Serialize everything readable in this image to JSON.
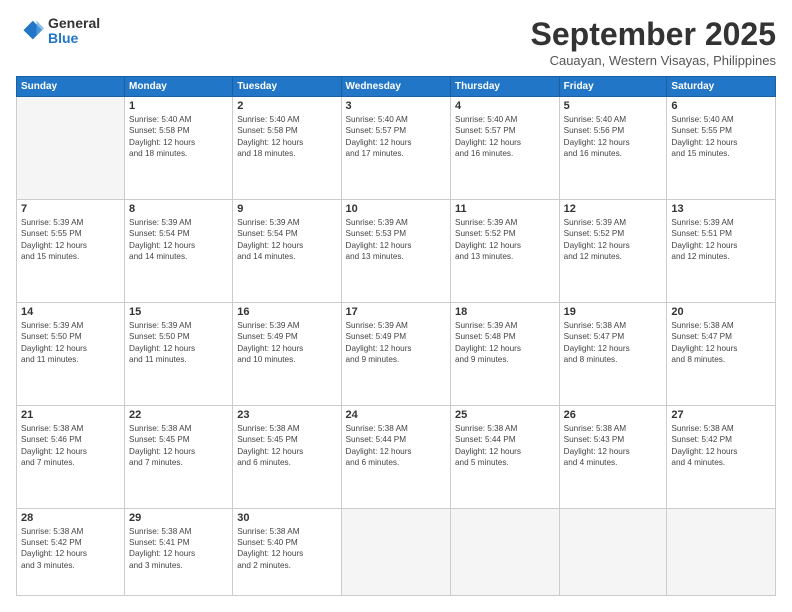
{
  "logo": {
    "general": "General",
    "blue": "Blue"
  },
  "title": "September 2025",
  "location": "Cauayan, Western Visayas, Philippines",
  "days_of_week": [
    "Sunday",
    "Monday",
    "Tuesday",
    "Wednesday",
    "Thursday",
    "Friday",
    "Saturday"
  ],
  "weeks": [
    [
      {
        "day": "",
        "info": ""
      },
      {
        "day": "1",
        "info": "Sunrise: 5:40 AM\nSunset: 5:58 PM\nDaylight: 12 hours\nand 18 minutes."
      },
      {
        "day": "2",
        "info": "Sunrise: 5:40 AM\nSunset: 5:58 PM\nDaylight: 12 hours\nand 18 minutes."
      },
      {
        "day": "3",
        "info": "Sunrise: 5:40 AM\nSunset: 5:57 PM\nDaylight: 12 hours\nand 17 minutes."
      },
      {
        "day": "4",
        "info": "Sunrise: 5:40 AM\nSunset: 5:57 PM\nDaylight: 12 hours\nand 16 minutes."
      },
      {
        "day": "5",
        "info": "Sunrise: 5:40 AM\nSunset: 5:56 PM\nDaylight: 12 hours\nand 16 minutes."
      },
      {
        "day": "6",
        "info": "Sunrise: 5:40 AM\nSunset: 5:55 PM\nDaylight: 12 hours\nand 15 minutes."
      }
    ],
    [
      {
        "day": "7",
        "info": "Sunrise: 5:39 AM\nSunset: 5:55 PM\nDaylight: 12 hours\nand 15 minutes."
      },
      {
        "day": "8",
        "info": "Sunrise: 5:39 AM\nSunset: 5:54 PM\nDaylight: 12 hours\nand 14 minutes."
      },
      {
        "day": "9",
        "info": "Sunrise: 5:39 AM\nSunset: 5:54 PM\nDaylight: 12 hours\nand 14 minutes."
      },
      {
        "day": "10",
        "info": "Sunrise: 5:39 AM\nSunset: 5:53 PM\nDaylight: 12 hours\nand 13 minutes."
      },
      {
        "day": "11",
        "info": "Sunrise: 5:39 AM\nSunset: 5:52 PM\nDaylight: 12 hours\nand 13 minutes."
      },
      {
        "day": "12",
        "info": "Sunrise: 5:39 AM\nSunset: 5:52 PM\nDaylight: 12 hours\nand 12 minutes."
      },
      {
        "day": "13",
        "info": "Sunrise: 5:39 AM\nSunset: 5:51 PM\nDaylight: 12 hours\nand 12 minutes."
      }
    ],
    [
      {
        "day": "14",
        "info": "Sunrise: 5:39 AM\nSunset: 5:50 PM\nDaylight: 12 hours\nand 11 minutes."
      },
      {
        "day": "15",
        "info": "Sunrise: 5:39 AM\nSunset: 5:50 PM\nDaylight: 12 hours\nand 11 minutes."
      },
      {
        "day": "16",
        "info": "Sunrise: 5:39 AM\nSunset: 5:49 PM\nDaylight: 12 hours\nand 10 minutes."
      },
      {
        "day": "17",
        "info": "Sunrise: 5:39 AM\nSunset: 5:49 PM\nDaylight: 12 hours\nand 9 minutes."
      },
      {
        "day": "18",
        "info": "Sunrise: 5:39 AM\nSunset: 5:48 PM\nDaylight: 12 hours\nand 9 minutes."
      },
      {
        "day": "19",
        "info": "Sunrise: 5:38 AM\nSunset: 5:47 PM\nDaylight: 12 hours\nand 8 minutes."
      },
      {
        "day": "20",
        "info": "Sunrise: 5:38 AM\nSunset: 5:47 PM\nDaylight: 12 hours\nand 8 minutes."
      }
    ],
    [
      {
        "day": "21",
        "info": "Sunrise: 5:38 AM\nSunset: 5:46 PM\nDaylight: 12 hours\nand 7 minutes."
      },
      {
        "day": "22",
        "info": "Sunrise: 5:38 AM\nSunset: 5:45 PM\nDaylight: 12 hours\nand 7 minutes."
      },
      {
        "day": "23",
        "info": "Sunrise: 5:38 AM\nSunset: 5:45 PM\nDaylight: 12 hours\nand 6 minutes."
      },
      {
        "day": "24",
        "info": "Sunrise: 5:38 AM\nSunset: 5:44 PM\nDaylight: 12 hours\nand 6 minutes."
      },
      {
        "day": "25",
        "info": "Sunrise: 5:38 AM\nSunset: 5:44 PM\nDaylight: 12 hours\nand 5 minutes."
      },
      {
        "day": "26",
        "info": "Sunrise: 5:38 AM\nSunset: 5:43 PM\nDaylight: 12 hours\nand 4 minutes."
      },
      {
        "day": "27",
        "info": "Sunrise: 5:38 AM\nSunset: 5:42 PM\nDaylight: 12 hours\nand 4 minutes."
      }
    ],
    [
      {
        "day": "28",
        "info": "Sunrise: 5:38 AM\nSunset: 5:42 PM\nDaylight: 12 hours\nand 3 minutes."
      },
      {
        "day": "29",
        "info": "Sunrise: 5:38 AM\nSunset: 5:41 PM\nDaylight: 12 hours\nand 3 minutes."
      },
      {
        "day": "30",
        "info": "Sunrise: 5:38 AM\nSunset: 5:40 PM\nDaylight: 12 hours\nand 2 minutes."
      },
      {
        "day": "",
        "info": ""
      },
      {
        "day": "",
        "info": ""
      },
      {
        "day": "",
        "info": ""
      },
      {
        "day": "",
        "info": ""
      }
    ]
  ]
}
